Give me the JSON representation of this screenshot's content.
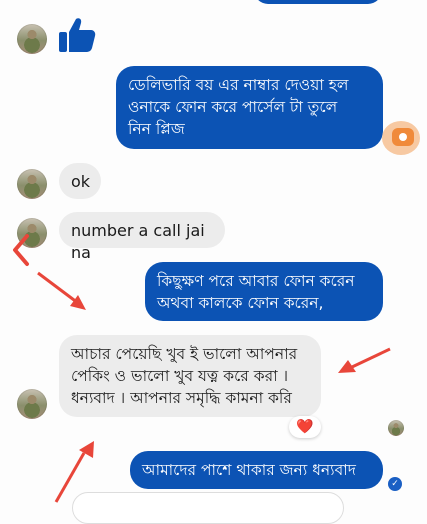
{
  "messages": {
    "outgoing_1": "ডেলিভারি বয় এর নাম্বার দেওয়া হল\nওনাকে ফোন করে পার্সেল টা তুলে\nনিন প্লিজ",
    "incoming_ok": "ok",
    "incoming_number": "number a call jai na",
    "outgoing_2": "কিছুক্ষণ পরে আবার ফোন করেন\nঅথবা কালকে ফোন করেন,",
    "incoming_review": "আচার পেয়েছি খুব ই ভালো আপনার\nপেকিং ও ভালো খুব যত্ন করে করা ।\nধন্যবাদ । আপনার সমৃদ্ধি কামনা করি",
    "outgoing_3": "আমাদের পাশে থাকার জন্য ধন্যবাদ"
  },
  "reaction": {
    "emoji": "❤️"
  },
  "icons": {
    "like": "thumbs-up-icon",
    "camera": "camera-icon",
    "seen": "seen-check-icon",
    "back": "back-arrow-icon"
  },
  "colors": {
    "outgoing_bubble": "#0c53b4",
    "incoming_bubble": "#ececec",
    "like_icon": "#0c53b4",
    "annotation_arrow": "#e8463a",
    "reaction_heart": "#e3163a"
  }
}
